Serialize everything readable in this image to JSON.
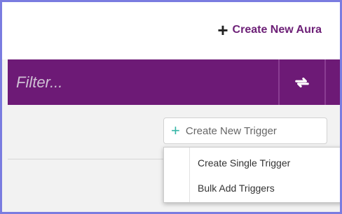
{
  "header": {
    "create_aura_label": "Create New Aura"
  },
  "filter": {
    "placeholder": "Filter..."
  },
  "triggers": {
    "create_new_trigger_label": "Create New Trigger",
    "menu": [
      {
        "label": "Create Single Trigger"
      },
      {
        "label": "Bulk Add Triggers"
      }
    ]
  },
  "icons": {
    "create_aura": "plus-icon",
    "refresh": "refresh-icon",
    "create_trigger": "plus-icon"
  },
  "colors": {
    "accent": "#6d1a76",
    "trigger_plus": "#35b5a6"
  }
}
